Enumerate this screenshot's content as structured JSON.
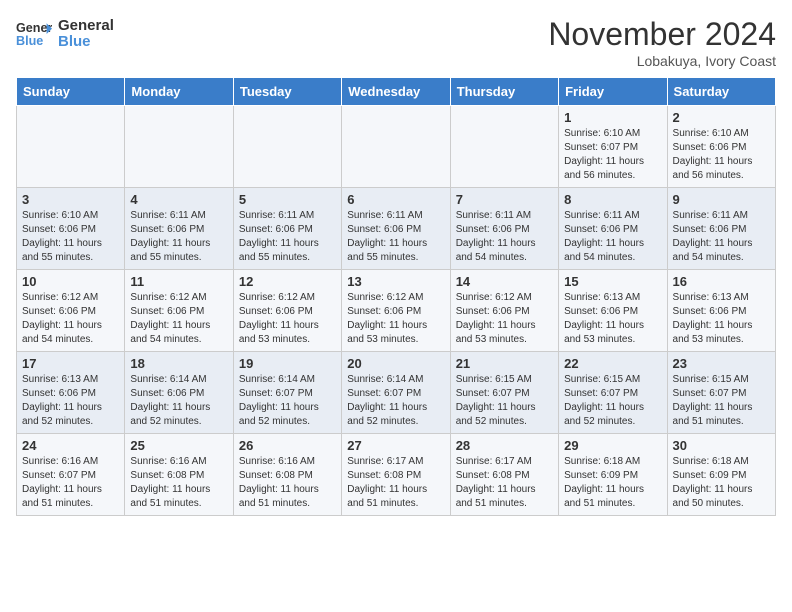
{
  "header": {
    "logo_line1": "General",
    "logo_line2": "Blue",
    "month": "November 2024",
    "location": "Lobakuya, Ivory Coast"
  },
  "weekdays": [
    "Sunday",
    "Monday",
    "Tuesday",
    "Wednesday",
    "Thursday",
    "Friday",
    "Saturday"
  ],
  "weeks": [
    [
      {
        "day": "",
        "info": ""
      },
      {
        "day": "",
        "info": ""
      },
      {
        "day": "",
        "info": ""
      },
      {
        "day": "",
        "info": ""
      },
      {
        "day": "",
        "info": ""
      },
      {
        "day": "1",
        "info": "Sunrise: 6:10 AM\nSunset: 6:07 PM\nDaylight: 11 hours\nand 56 minutes."
      },
      {
        "day": "2",
        "info": "Sunrise: 6:10 AM\nSunset: 6:06 PM\nDaylight: 11 hours\nand 56 minutes."
      }
    ],
    [
      {
        "day": "3",
        "info": "Sunrise: 6:10 AM\nSunset: 6:06 PM\nDaylight: 11 hours\nand 55 minutes."
      },
      {
        "day": "4",
        "info": "Sunrise: 6:11 AM\nSunset: 6:06 PM\nDaylight: 11 hours\nand 55 minutes."
      },
      {
        "day": "5",
        "info": "Sunrise: 6:11 AM\nSunset: 6:06 PM\nDaylight: 11 hours\nand 55 minutes."
      },
      {
        "day": "6",
        "info": "Sunrise: 6:11 AM\nSunset: 6:06 PM\nDaylight: 11 hours\nand 55 minutes."
      },
      {
        "day": "7",
        "info": "Sunrise: 6:11 AM\nSunset: 6:06 PM\nDaylight: 11 hours\nand 54 minutes."
      },
      {
        "day": "8",
        "info": "Sunrise: 6:11 AM\nSunset: 6:06 PM\nDaylight: 11 hours\nand 54 minutes."
      },
      {
        "day": "9",
        "info": "Sunrise: 6:11 AM\nSunset: 6:06 PM\nDaylight: 11 hours\nand 54 minutes."
      }
    ],
    [
      {
        "day": "10",
        "info": "Sunrise: 6:12 AM\nSunset: 6:06 PM\nDaylight: 11 hours\nand 54 minutes."
      },
      {
        "day": "11",
        "info": "Sunrise: 6:12 AM\nSunset: 6:06 PM\nDaylight: 11 hours\nand 54 minutes."
      },
      {
        "day": "12",
        "info": "Sunrise: 6:12 AM\nSunset: 6:06 PM\nDaylight: 11 hours\nand 53 minutes."
      },
      {
        "day": "13",
        "info": "Sunrise: 6:12 AM\nSunset: 6:06 PM\nDaylight: 11 hours\nand 53 minutes."
      },
      {
        "day": "14",
        "info": "Sunrise: 6:12 AM\nSunset: 6:06 PM\nDaylight: 11 hours\nand 53 minutes."
      },
      {
        "day": "15",
        "info": "Sunrise: 6:13 AM\nSunset: 6:06 PM\nDaylight: 11 hours\nand 53 minutes."
      },
      {
        "day": "16",
        "info": "Sunrise: 6:13 AM\nSunset: 6:06 PM\nDaylight: 11 hours\nand 53 minutes."
      }
    ],
    [
      {
        "day": "17",
        "info": "Sunrise: 6:13 AM\nSunset: 6:06 PM\nDaylight: 11 hours\nand 52 minutes."
      },
      {
        "day": "18",
        "info": "Sunrise: 6:14 AM\nSunset: 6:06 PM\nDaylight: 11 hours\nand 52 minutes."
      },
      {
        "day": "19",
        "info": "Sunrise: 6:14 AM\nSunset: 6:07 PM\nDaylight: 11 hours\nand 52 minutes."
      },
      {
        "day": "20",
        "info": "Sunrise: 6:14 AM\nSunset: 6:07 PM\nDaylight: 11 hours\nand 52 minutes."
      },
      {
        "day": "21",
        "info": "Sunrise: 6:15 AM\nSunset: 6:07 PM\nDaylight: 11 hours\nand 52 minutes."
      },
      {
        "day": "22",
        "info": "Sunrise: 6:15 AM\nSunset: 6:07 PM\nDaylight: 11 hours\nand 52 minutes."
      },
      {
        "day": "23",
        "info": "Sunrise: 6:15 AM\nSunset: 6:07 PM\nDaylight: 11 hours\nand 51 minutes."
      }
    ],
    [
      {
        "day": "24",
        "info": "Sunrise: 6:16 AM\nSunset: 6:07 PM\nDaylight: 11 hours\nand 51 minutes."
      },
      {
        "day": "25",
        "info": "Sunrise: 6:16 AM\nSunset: 6:08 PM\nDaylight: 11 hours\nand 51 minutes."
      },
      {
        "day": "26",
        "info": "Sunrise: 6:16 AM\nSunset: 6:08 PM\nDaylight: 11 hours\nand 51 minutes."
      },
      {
        "day": "27",
        "info": "Sunrise: 6:17 AM\nSunset: 6:08 PM\nDaylight: 11 hours\nand 51 minutes."
      },
      {
        "day": "28",
        "info": "Sunrise: 6:17 AM\nSunset: 6:08 PM\nDaylight: 11 hours\nand 51 minutes."
      },
      {
        "day": "29",
        "info": "Sunrise: 6:18 AM\nSunset: 6:09 PM\nDaylight: 11 hours\nand 51 minutes."
      },
      {
        "day": "30",
        "info": "Sunrise: 6:18 AM\nSunset: 6:09 PM\nDaylight: 11 hours\nand 50 minutes."
      }
    ]
  ]
}
